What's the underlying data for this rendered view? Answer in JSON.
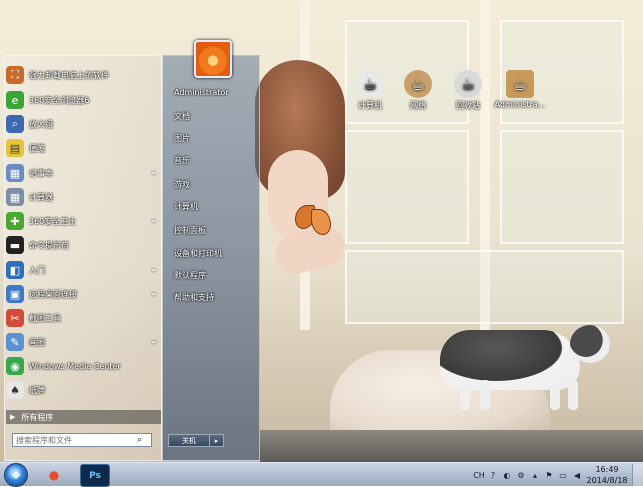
{
  "desktop": {
    "icons": [
      {
        "label": "计算机",
        "name": "computer",
        "icon": "computer-icon",
        "color": "#e8e8e8"
      },
      {
        "label": "网络",
        "name": "network",
        "icon": "network-icon",
        "color": "#c9a06a"
      },
      {
        "label": "回收站",
        "name": "recycle-bin",
        "icon": "recycle-bin-icon",
        "color": "#d9d9d9"
      },
      {
        "label": "Administra...",
        "name": "user-folder",
        "icon": "folder-icon",
        "color": "#c79a5c"
      }
    ]
  },
  "start_menu": {
    "programs": [
      {
        "label": "强力卸载电脑上的软件",
        "icon": "uninstall-icon",
        "color": "#c86a2a",
        "glyph": "⛶",
        "arrow": false
      },
      {
        "label": "360安全浏览器6",
        "icon": "browser-360-icon",
        "color": "#3aa63a",
        "glyph": "e",
        "arrow": false
      },
      {
        "label": "放大镜",
        "icon": "magnifier-icon",
        "color": "#3b6ab0",
        "glyph": "⌕",
        "arrow": false
      },
      {
        "label": "便笺",
        "icon": "sticky-note-icon",
        "color": "#e8c43c",
        "glyph": "▤",
        "arrow": false
      },
      {
        "label": "记事本",
        "icon": "notepad-icon",
        "color": "#6a8cc0",
        "glyph": "▦",
        "arrow": true
      },
      {
        "label": "计算器",
        "icon": "calculator-icon",
        "color": "#7a8ea8",
        "glyph": "▦",
        "arrow": false
      },
      {
        "label": "360安全卫士",
        "icon": "security-360-icon",
        "color": "#4aa82e",
        "glyph": "✚",
        "arrow": true
      },
      {
        "label": "命令提示符",
        "icon": "command-prompt-icon",
        "color": "#222222",
        "glyph": "▬",
        "arrow": false
      },
      {
        "label": "入门",
        "icon": "getting-started-icon",
        "color": "#2f6fbf",
        "glyph": "◧",
        "arrow": true
      },
      {
        "label": "远程桌面连接",
        "icon": "remote-desktop-icon",
        "color": "#3d79c6",
        "glyph": "▣",
        "arrow": true
      },
      {
        "label": "截图工具",
        "icon": "snipping-tool-icon",
        "color": "#d24a3a",
        "glyph": "✂",
        "arrow": false
      },
      {
        "label": "画图",
        "icon": "paint-icon",
        "color": "#5a93d2",
        "glyph": "✎",
        "arrow": true
      },
      {
        "label": "Windows Media Center",
        "icon": "media-center-icon",
        "color": "#3aa84a",
        "glyph": "◉",
        "arrow": false
      },
      {
        "label": "纸牌",
        "icon": "solitaire-icon",
        "color": "#e6e6e6",
        "glyph": "♠",
        "arrow": false
      }
    ],
    "all_programs": "所有程序",
    "search_placeholder": "搜索程序和文件",
    "user_name": "Administrator",
    "right_items": [
      "文档",
      "图片",
      "音乐",
      "游戏",
      "计算机",
      "控制面板",
      "设备和打印机",
      "默认程序",
      "帮助和支持"
    ],
    "shutdown_label": "关机"
  },
  "taskbar": {
    "apps": [
      {
        "name": "media-player",
        "icon": "media-player-icon",
        "glyph": "●"
      },
      {
        "name": "photoshop",
        "icon": "photoshop-icon",
        "glyph": "Ps"
      }
    ],
    "tray": {
      "ime": "CH",
      "time": "16:49",
      "date": "2014/8/18"
    }
  }
}
